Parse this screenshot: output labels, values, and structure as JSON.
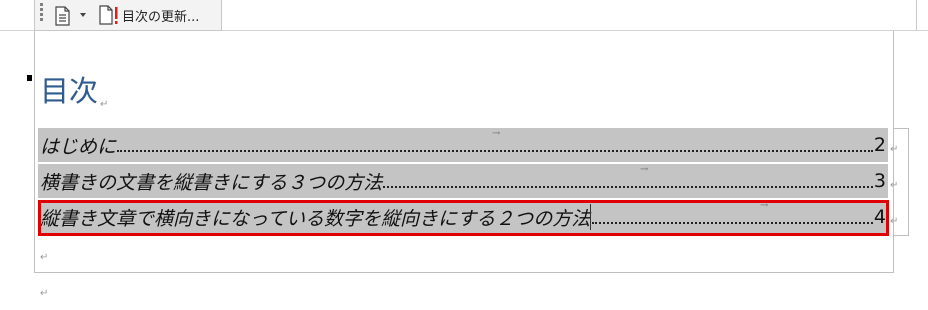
{
  "toolbar": {
    "update_label": "目次の更新..."
  },
  "heading": {
    "title": "目次"
  },
  "paragraph_mark": "↵",
  "tab_mark": "→",
  "toc": {
    "entries": [
      {
        "text": "はじめに",
        "page": "2"
      },
      {
        "text": "横書きの文書を縦書きにする３つの方法",
        "page": "3"
      },
      {
        "text": "縦書き文章で横向きになっている数字を縦向きにする２つの方法",
        "page": "4"
      }
    ]
  },
  "colors": {
    "heading": "#2f5b8f",
    "field_shading": "#c4c4c4",
    "highlight_box": "#e00000"
  },
  "icons": [
    "document-icon",
    "update-table-icon",
    "paragraph-mark-icon",
    "tab-arrow-icon"
  ]
}
